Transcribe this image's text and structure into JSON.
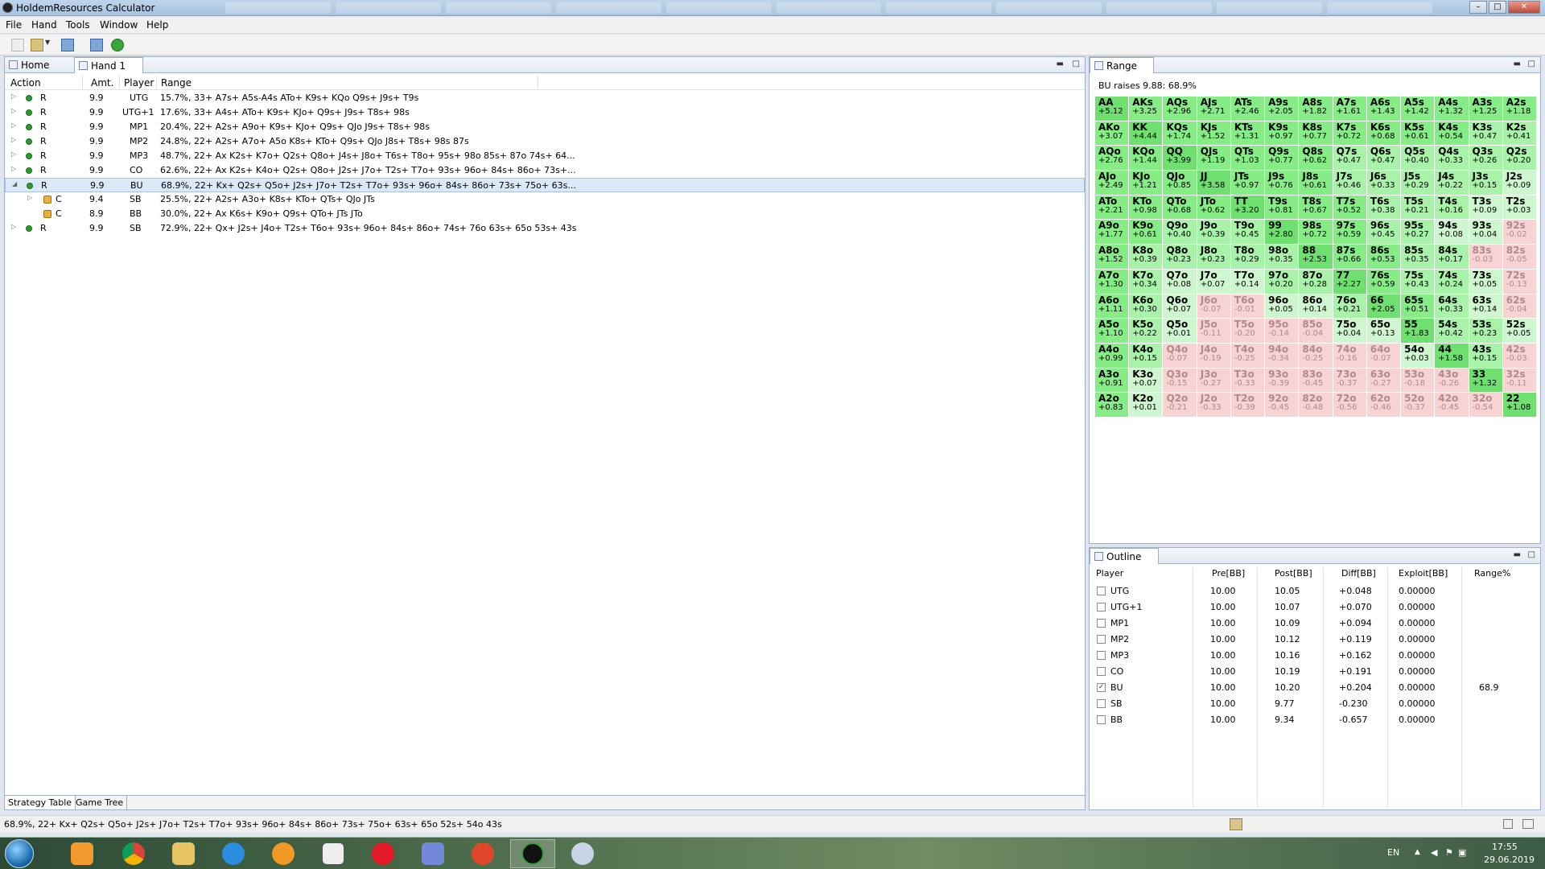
{
  "window": {
    "title": "HoldemResources Calculator"
  },
  "menu": [
    "File",
    "Hand",
    "Tools",
    "Window",
    "Help"
  ],
  "editor": {
    "tabs": [
      {
        "label": "Home"
      },
      {
        "label": "Hand 1"
      }
    ],
    "columns": {
      "action": "Action",
      "amt": "Amt.",
      "player": "Player",
      "range": "Range"
    },
    "rows": [
      {
        "arrow": "▷",
        "action": "R",
        "amt": "9.9",
        "player": "UTG",
        "range": "15.7%, 33+ A7s+ A5s-A4s ATo+ K9s+ KQo Q9s+ J9s+ T9s"
      },
      {
        "arrow": "▷",
        "action": "R",
        "amt": "9.9",
        "player": "UTG+1",
        "range": "17.6%, 33+ A4s+ ATo+ K9s+ KJo+ Q9s+ J9s+ T8s+ 98s"
      },
      {
        "arrow": "▷",
        "action": "R",
        "amt": "9.9",
        "player": "MP1",
        "range": "20.4%, 22+ A2s+ A9o+ K9s+ KJo+ Q9s+ QJo J9s+ T8s+ 98s"
      },
      {
        "arrow": "▷",
        "action": "R",
        "amt": "9.9",
        "player": "MP2",
        "range": "24.8%, 22+ A2s+ A7o+ A5o K8s+ KTo+ Q9s+ QJo J8s+ T8s+ 98s 87s"
      },
      {
        "arrow": "▷",
        "action": "R",
        "amt": "9.9",
        "player": "MP3",
        "range": "48.7%, 22+ Ax K2s+ K7o+ Q2s+ Q8o+ J4s+ J8o+ T6s+ T8o+ 95s+ 98o 85s+ 87o 74s+ 64..."
      },
      {
        "arrow": "▷",
        "action": "R",
        "amt": "9.9",
        "player": "CO",
        "range": "62.6%, 22+ Ax K2s+ K4o+ Q2s+ Q8o+ J2s+ J7o+ T2s+ T7o+ 93s+ 96o+ 84s+ 86o+ 73s+..."
      },
      {
        "arrow": "◢",
        "action": "R",
        "amt": "9.9",
        "player": "BU",
        "range": "68.9%, 22+ Kx+ Q2s+ Q5o+ J2s+ J7o+ T2s+ T7o+ 93s+ 96o+ 84s+ 86o+ 73s+ 75o+ 63s...",
        "selected": true
      },
      {
        "arrow": "▷",
        "action": "C",
        "amt": "9.4",
        "player": "SB",
        "range": "25.5%, 22+ A2s+ A3o+ K8s+ KTo+ QTs+ QJo JTs",
        "child": true
      },
      {
        "arrow": "",
        "action": "C",
        "amt": "8.9",
        "player": "BB",
        "range": "30.0%, 22+ Ax K6s+ K9o+ Q9s+ QTo+ JTs JTo",
        "child": true
      },
      {
        "arrow": "▷",
        "action": "R",
        "amt": "9.9",
        "player": "SB",
        "range": "72.9%, 22+ Qx+ J2s+ J4o+ T2s+ T6o+ 93s+ 96o+ 84s+ 86o+ 74s+ 76o 63s+ 65o 53s+ 43s"
      }
    ],
    "bottom_tabs": [
      "Strategy Table",
      "Game Tree"
    ]
  },
  "range_panel": {
    "tab": "Range",
    "subtitle": "BU raises 9.88: 68.9%",
    "grid": [
      [
        [
          "AA",
          "+5.12"
        ],
        [
          "AKs",
          "+3.25"
        ],
        [
          "AQs",
          "+2.96"
        ],
        [
          "AJs",
          "+2.71"
        ],
        [
          "ATs",
          "+2.46"
        ],
        [
          "A9s",
          "+2.05"
        ],
        [
          "A8s",
          "+1.82"
        ],
        [
          "A7s",
          "+1.61"
        ],
        [
          "A6s",
          "+1.43"
        ],
        [
          "A5s",
          "+1.42"
        ],
        [
          "A4s",
          "+1.32"
        ],
        [
          "A3s",
          "+1.25"
        ],
        [
          "A2s",
          "+1.18"
        ]
      ],
      [
        [
          "AKo",
          "+3.07"
        ],
        [
          "KK",
          "+4.44"
        ],
        [
          "KQs",
          "+1.74"
        ],
        [
          "KJs",
          "+1.52"
        ],
        [
          "KTs",
          "+1.31"
        ],
        [
          "K9s",
          "+0.97"
        ],
        [
          "K8s",
          "+0.77"
        ],
        [
          "K7s",
          "+0.72"
        ],
        [
          "K6s",
          "+0.68"
        ],
        [
          "K5s",
          "+0.61"
        ],
        [
          "K4s",
          "+0.54"
        ],
        [
          "K3s",
          "+0.47"
        ],
        [
          "K2s",
          "+0.41"
        ]
      ],
      [
        [
          "AQo",
          "+2.76"
        ],
        [
          "KQo",
          "+1.44"
        ],
        [
          "QQ",
          "+3.99"
        ],
        [
          "QJs",
          "+1.19"
        ],
        [
          "QTs",
          "+1.03"
        ],
        [
          "Q9s",
          "+0.77"
        ],
        [
          "Q8s",
          "+0.62"
        ],
        [
          "Q7s",
          "+0.47"
        ],
        [
          "Q6s",
          "+0.47"
        ],
        [
          "Q5s",
          "+0.40"
        ],
        [
          "Q4s",
          "+0.33"
        ],
        [
          "Q3s",
          "+0.26"
        ],
        [
          "Q2s",
          "+0.20"
        ]
      ],
      [
        [
          "AJo",
          "+2.49"
        ],
        [
          "KJo",
          "+1.21"
        ],
        [
          "QJo",
          "+0.85"
        ],
        [
          "JJ",
          "+3.58"
        ],
        [
          "JTs",
          "+0.97"
        ],
        [
          "J9s",
          "+0.76"
        ],
        [
          "J8s",
          "+0.61"
        ],
        [
          "J7s",
          "+0.46"
        ],
        [
          "J6s",
          "+0.33"
        ],
        [
          "J5s",
          "+0.29"
        ],
        [
          "J4s",
          "+0.22"
        ],
        [
          "J3s",
          "+0.15"
        ],
        [
          "J2s",
          "+0.09"
        ]
      ],
      [
        [
          "ATo",
          "+2.21"
        ],
        [
          "KTo",
          "+0.98"
        ],
        [
          "QTo",
          "+0.68"
        ],
        [
          "JTo",
          "+0.62"
        ],
        [
          "TT",
          "+3.20"
        ],
        [
          "T9s",
          "+0.81"
        ],
        [
          "T8s",
          "+0.67"
        ],
        [
          "T7s",
          "+0.52"
        ],
        [
          "T6s",
          "+0.38"
        ],
        [
          "T5s",
          "+0.21"
        ],
        [
          "T4s",
          "+0.16"
        ],
        [
          "T3s",
          "+0.09"
        ],
        [
          "T2s",
          "+0.03"
        ]
      ],
      [
        [
          "A9o",
          "+1.77"
        ],
        [
          "K9o",
          "+0.61"
        ],
        [
          "Q9o",
          "+0.40"
        ],
        [
          "J9o",
          "+0.39"
        ],
        [
          "T9o",
          "+0.45"
        ],
        [
          "99",
          "+2.80"
        ],
        [
          "98s",
          "+0.72"
        ],
        [
          "97s",
          "+0.59"
        ],
        [
          "96s",
          "+0.45"
        ],
        [
          "95s",
          "+0.27"
        ],
        [
          "94s",
          "+0.08"
        ],
        [
          "93s",
          "+0.04"
        ],
        [
          "92s",
          "-0.02"
        ]
      ],
      [
        [
          "A8o",
          "+1.52"
        ],
        [
          "K8o",
          "+0.39"
        ],
        [
          "Q8o",
          "+0.23"
        ],
        [
          "J8o",
          "+0.23"
        ],
        [
          "T8o",
          "+0.29"
        ],
        [
          "98o",
          "+0.35"
        ],
        [
          "88",
          "+2.53"
        ],
        [
          "87s",
          "+0.66"
        ],
        [
          "86s",
          "+0.53"
        ],
        [
          "85s",
          "+0.35"
        ],
        [
          "84s",
          "+0.17"
        ],
        [
          "83s",
          "-0.03"
        ],
        [
          "82s",
          "-0.05"
        ]
      ],
      [
        [
          "A7o",
          "+1.30"
        ],
        [
          "K7o",
          "+0.34"
        ],
        [
          "Q7o",
          "+0.08"
        ],
        [
          "J7o",
          "+0.07"
        ],
        [
          "T7o",
          "+0.14"
        ],
        [
          "97o",
          "+0.20"
        ],
        [
          "87o",
          "+0.28"
        ],
        [
          "77",
          "+2.27"
        ],
        [
          "76s",
          "+0.59"
        ],
        [
          "75s",
          "+0.43"
        ],
        [
          "74s",
          "+0.24"
        ],
        [
          "73s",
          "+0.05"
        ],
        [
          "72s",
          "-0.13"
        ]
      ],
      [
        [
          "A6o",
          "+1.11"
        ],
        [
          "K6o",
          "+0.30"
        ],
        [
          "Q6o",
          "+0.07"
        ],
        [
          "J6o",
          "-0.07"
        ],
        [
          "T6o",
          "-0.01"
        ],
        [
          "96o",
          "+0.05"
        ],
        [
          "86o",
          "+0.14"
        ],
        [
          "76o",
          "+0.21"
        ],
        [
          "66",
          "+2.05"
        ],
        [
          "65s",
          "+0.51"
        ],
        [
          "64s",
          "+0.33"
        ],
        [
          "63s",
          "+0.14"
        ],
        [
          "62s",
          "-0.04"
        ]
      ],
      [
        [
          "A5o",
          "+1.10"
        ],
        [
          "K5o",
          "+0.22"
        ],
        [
          "Q5o",
          "+0.01"
        ],
        [
          "J5o",
          "-0.11"
        ],
        [
          "T5o",
          "-0.20"
        ],
        [
          "95o",
          "-0.14"
        ],
        [
          "85o",
          "-0.04"
        ],
        [
          "75o",
          "+0.04"
        ],
        [
          "65o",
          "+0.13"
        ],
        [
          "55",
          "+1.83"
        ],
        [
          "54s",
          "+0.42"
        ],
        [
          "53s",
          "+0.23"
        ],
        [
          "52s",
          "+0.05"
        ]
      ],
      [
        [
          "A4o",
          "+0.99"
        ],
        [
          "K4o",
          "+0.15"
        ],
        [
          "Q4o",
          "-0.07"
        ],
        [
          "J4o",
          "-0.19"
        ],
        [
          "T4o",
          "-0.25"
        ],
        [
          "94o",
          "-0.34"
        ],
        [
          "84o",
          "-0.25"
        ],
        [
          "74o",
          "-0.16"
        ],
        [
          "64o",
          "-0.07"
        ],
        [
          "54o",
          "+0.03"
        ],
        [
          "44",
          "+1.58"
        ],
        [
          "43s",
          "+0.15"
        ],
        [
          "42s",
          "-0.03"
        ]
      ],
      [
        [
          "A3o",
          "+0.91"
        ],
        [
          "K3o",
          "+0.07"
        ],
        [
          "Q3o",
          "-0.15"
        ],
        [
          "J3o",
          "-0.27"
        ],
        [
          "T3o",
          "-0.33"
        ],
        [
          "93o",
          "-0.39"
        ],
        [
          "83o",
          "-0.45"
        ],
        [
          "73o",
          "-0.37"
        ],
        [
          "63o",
          "-0.27"
        ],
        [
          "53o",
          "-0.18"
        ],
        [
          "43o",
          "-0.26"
        ],
        [
          "33",
          "+1.32"
        ],
        [
          "32s",
          "-0.11"
        ]
      ],
      [
        [
          "A2o",
          "+0.83"
        ],
        [
          "K2o",
          "+0.01"
        ],
        [
          "Q2o",
          "-0.21"
        ],
        [
          "J2o",
          "-0.33"
        ],
        [
          "T2o",
          "-0.39"
        ],
        [
          "92o",
          "-0.45"
        ],
        [
          "82o",
          "-0.48"
        ],
        [
          "72o",
          "-0.56"
        ],
        [
          "62o",
          "-0.46"
        ],
        [
          "52o",
          "-0.37"
        ],
        [
          "42o",
          "-0.45"
        ],
        [
          "32o",
          "-0.54"
        ],
        [
          "22",
          "+1.08"
        ]
      ]
    ]
  },
  "outline": {
    "tab": "Outline",
    "headers": [
      "Player",
      "Pre[BB]",
      "Post[BB]",
      "Diff[BB]",
      "Exploit[BB]",
      "Range%"
    ],
    "rows": [
      {
        "player": "UTG",
        "pre": "10.00",
        "post": "10.05",
        "diff": "+0.048",
        "exploit": "0.00000",
        "range": "",
        "checked": false
      },
      {
        "player": "UTG+1",
        "pre": "10.00",
        "post": "10.07",
        "diff": "+0.070",
        "exploit": "0.00000",
        "range": "",
        "checked": false
      },
      {
        "player": "MP1",
        "pre": "10.00",
        "post": "10.09",
        "diff": "+0.094",
        "exploit": "0.00000",
        "range": "",
        "checked": false
      },
      {
        "player": "MP2",
        "pre": "10.00",
        "post": "10.12",
        "diff": "+0.119",
        "exploit": "0.00000",
        "range": "",
        "checked": false
      },
      {
        "player": "MP3",
        "pre": "10.00",
        "post": "10.16",
        "diff": "+0.162",
        "exploit": "0.00000",
        "range": "",
        "checked": false
      },
      {
        "player": "CO",
        "pre": "10.00",
        "post": "10.19",
        "diff": "+0.191",
        "exploit": "0.00000",
        "range": "",
        "checked": false
      },
      {
        "player": "BU",
        "pre": "10.00",
        "post": "10.20",
        "diff": "+0.204",
        "exploit": "0.00000",
        "range": "68.9",
        "checked": true
      },
      {
        "player": "SB",
        "pre": "10.00",
        "post": "9.77",
        "diff": "-0.230",
        "exploit": "0.00000",
        "range": "",
        "checked": false
      },
      {
        "player": "BB",
        "pre": "10.00",
        "post": "9.34",
        "diff": "-0.657",
        "exploit": "0.00000",
        "range": "",
        "checked": false
      }
    ]
  },
  "status": {
    "text": "68.9%, 22+ Kx+ Q2s+ Q5o+ J2s+ J7o+ T2s+ T7o+ 93s+ 96o+ 84s+ 86o+ 73s+ 75o+ 63s+ 65o 52s+ 54o 43s"
  },
  "taskbar": {
    "lang": "EN",
    "time": "17:55",
    "date": "29.06.2019"
  }
}
